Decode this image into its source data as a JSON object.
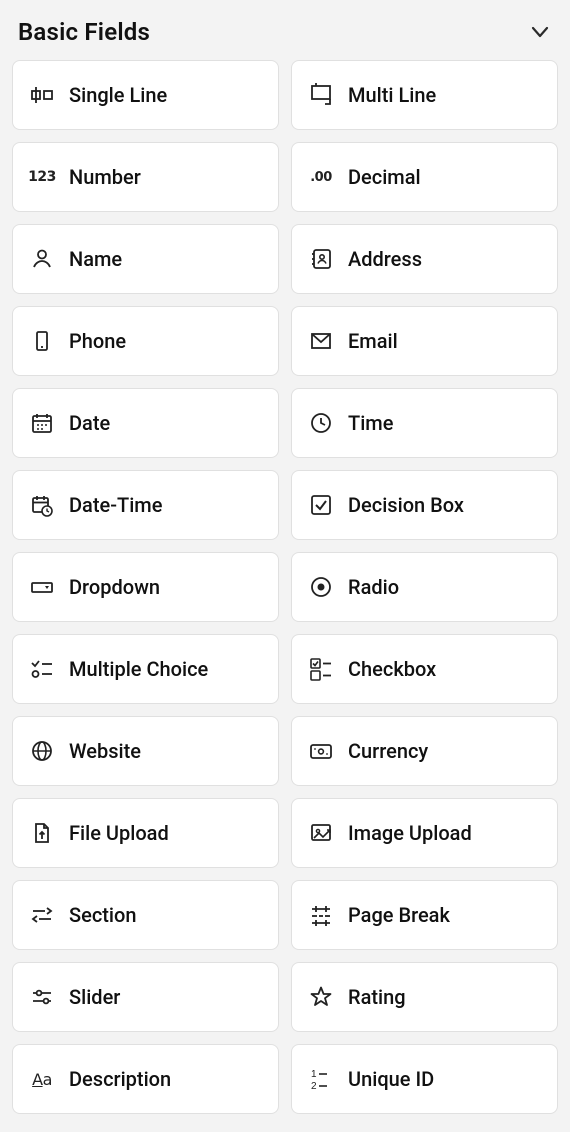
{
  "section": {
    "title": "Basic Fields",
    "fields": [
      {
        "id": "single-line",
        "label": "Single Line",
        "icon": "single-line-icon"
      },
      {
        "id": "multi-line",
        "label": "Multi Line",
        "icon": "multi-line-icon"
      },
      {
        "id": "number",
        "label": "Number",
        "icon": "number-icon"
      },
      {
        "id": "decimal",
        "label": "Decimal",
        "icon": "decimal-icon"
      },
      {
        "id": "name",
        "label": "Name",
        "icon": "person-icon"
      },
      {
        "id": "address",
        "label": "Address",
        "icon": "address-book-icon"
      },
      {
        "id": "phone",
        "label": "Phone",
        "icon": "phone-icon"
      },
      {
        "id": "email",
        "label": "Email",
        "icon": "envelope-icon"
      },
      {
        "id": "date",
        "label": "Date",
        "icon": "calendar-icon"
      },
      {
        "id": "time",
        "label": "Time",
        "icon": "clock-icon"
      },
      {
        "id": "date-time",
        "label": "Date-Time",
        "icon": "calendar-clock-icon"
      },
      {
        "id": "decision-box",
        "label": "Decision Box",
        "icon": "check-square-icon"
      },
      {
        "id": "dropdown",
        "label": "Dropdown",
        "icon": "dropdown-icon"
      },
      {
        "id": "radio",
        "label": "Radio",
        "icon": "radio-icon"
      },
      {
        "id": "multiple-choice",
        "label": "Multiple Choice",
        "icon": "multiple-choice-icon"
      },
      {
        "id": "checkbox",
        "label": "Checkbox",
        "icon": "checkbox-list-icon"
      },
      {
        "id": "website",
        "label": "Website",
        "icon": "globe-icon"
      },
      {
        "id": "currency",
        "label": "Currency",
        "icon": "currency-icon"
      },
      {
        "id": "file-upload",
        "label": "File Upload",
        "icon": "file-upload-icon"
      },
      {
        "id": "image-upload",
        "label": "Image Upload",
        "icon": "image-upload-icon"
      },
      {
        "id": "section",
        "label": "Section",
        "icon": "section-icon"
      },
      {
        "id": "page-break",
        "label": "Page Break",
        "icon": "page-break-icon"
      },
      {
        "id": "slider",
        "label": "Slider",
        "icon": "slider-icon"
      },
      {
        "id": "rating",
        "label": "Rating",
        "icon": "star-icon"
      },
      {
        "id": "description",
        "label": "Description",
        "icon": "description-icon"
      },
      {
        "id": "unique-id",
        "label": "Unique ID",
        "icon": "unique-id-icon"
      }
    ]
  }
}
